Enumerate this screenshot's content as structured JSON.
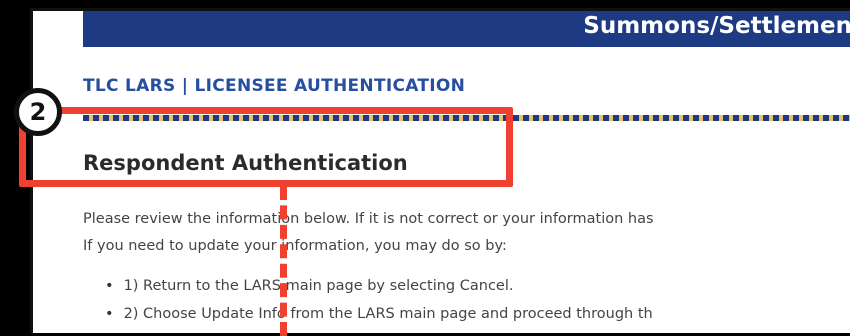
{
  "banner": {
    "text": "Summons/Settlement"
  },
  "breadcrumb": {
    "text": "TLC LARS | LICENSEE AUTHENTICATION"
  },
  "page_title": "Respondent Authentication",
  "instructions": {
    "line1": "Please review the information below. If it is not correct or your information has",
    "line2": "If you need to update your information, you may do so by:"
  },
  "steps": [
    "1) Return to the LARS main page by selecting Cancel.",
    "2) Choose Update Info from the LARS main page and proceed through th"
  ],
  "callout": {
    "number": "2",
    "color": "#f04030"
  },
  "colors": {
    "banner": "#1e3a82",
    "breadcrumb": "#274fa0",
    "title": "#2b2b2b"
  }
}
